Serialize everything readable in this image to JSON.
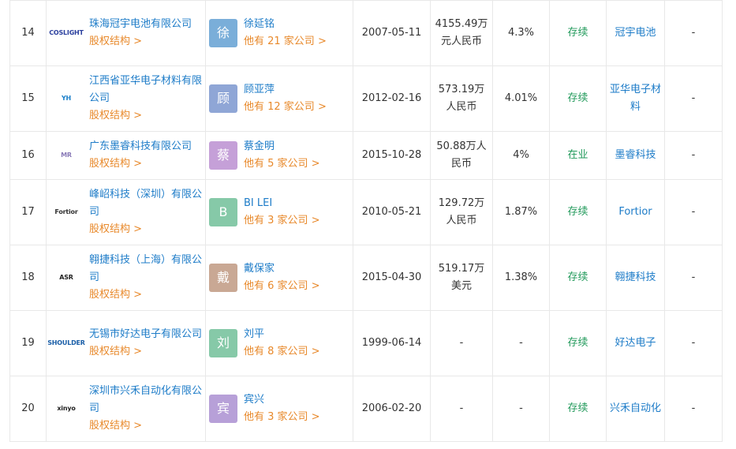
{
  "rows": [
    {
      "index": "14",
      "company": "珠海冠宇电池有限公司",
      "logo": "COSLIGHT",
      "logo_color": "#2a3f9e",
      "equity": "股权结构 >",
      "avatar": "徐",
      "avatar_color": "#7aaed9",
      "person": "徐延铭",
      "other": "他有 21 家公司 >",
      "date": "2007-05-11",
      "capital": "4155.49万元人民币",
      "ratio": "4.3%",
      "status": "存续",
      "brand": "冠宇电池",
      "last": "-"
    },
    {
      "index": "15",
      "company": "江西省亚华电子材料有限公司",
      "logo": "YH",
      "logo_color": "#1b7fc9",
      "equity": "股权结构 >",
      "avatar": "顾",
      "avatar_color": "#8fa6d6",
      "person": "顾亚萍",
      "other": "他有 12 家公司 >",
      "date": "2012-02-16",
      "capital": "573.19万人民币",
      "ratio": "4.01%",
      "status": "存续",
      "brand": "亚华电子材料",
      "last": "-"
    },
    {
      "index": "16",
      "company": "广东墨睿科技有限公司",
      "logo": "MR",
      "logo_color": "#8a7bb8",
      "equity": "股权结构 >",
      "avatar": "蔡",
      "avatar_color": "#c5a0d8",
      "person": "蔡金明",
      "other": "他有 5 家公司 >",
      "date": "2015-10-28",
      "capital": "50.88万人民币",
      "ratio": "4%",
      "status": "在业",
      "brand": "墨睿科技",
      "last": "-"
    },
    {
      "index": "17",
      "company": "峰岹科技（深圳）有限公司",
      "logo": "Fortior",
      "logo_color": "#333333",
      "equity": "股权结构 >",
      "avatar": "B",
      "avatar_color": "#86c9a8",
      "person": "BI LEI",
      "other": "他有 3 家公司 >",
      "date": "2010-05-21",
      "capital": "129.72万人民币",
      "ratio": "1.87%",
      "status": "存续",
      "brand": "Fortior",
      "last": "-"
    },
    {
      "index": "18",
      "company": "翱捷科技（上海）有限公司",
      "logo": "ASR",
      "logo_color": "#222222",
      "equity": "股权结构 >",
      "avatar": "戴",
      "avatar_color": "#c9a894",
      "person": "戴保家",
      "other": "他有 6 家公司 >",
      "date": "2015-04-30",
      "capital": "519.17万美元",
      "ratio": "1.38%",
      "status": "存续",
      "brand": "翱捷科技",
      "last": "-"
    },
    {
      "index": "19",
      "company": "无锡市好达电子有限公司",
      "logo": "SHOULDER",
      "logo_color": "#1b5fa8",
      "equity": "股权结构 >",
      "avatar": "刘",
      "avatar_color": "#86c9a8",
      "person": "刘平",
      "other": "他有 8 家公司 >",
      "date": "1999-06-14",
      "capital": "-",
      "ratio": "-",
      "status": "存续",
      "brand": "好达电子",
      "last": "-"
    },
    {
      "index": "20",
      "company": "深圳市兴禾自动化有限公司",
      "logo": "xinyo",
      "logo_color": "#222222",
      "equity": "股权结构 >",
      "avatar": "宾",
      "avatar_color": "#b7a0d8",
      "person": "宾兴",
      "other": "他有 3 家公司 >",
      "date": "2006-02-20",
      "capital": "-",
      "ratio": "-",
      "status": "存续",
      "brand": "兴禾自动化",
      "last": "-"
    }
  ]
}
